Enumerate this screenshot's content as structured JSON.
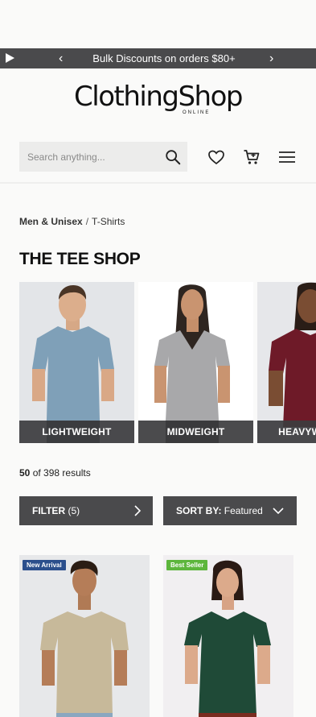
{
  "promo": {
    "text": "Bulk Discounts on  orders $80+",
    "play_icon": "play-icon",
    "prev_icon": "chevron-left-icon",
    "next_icon": "chevron-right-icon"
  },
  "logo": {
    "main": "ClothingShop",
    "sub": "ONLINE"
  },
  "search": {
    "placeholder": "Search anything...",
    "icon": "search-icon"
  },
  "header_icons": [
    "heart-icon",
    "cart-icon",
    "menu-icon"
  ],
  "breadcrumb": {
    "parent": "Men & Unisex",
    "separator": "/",
    "current": "T-Shirts"
  },
  "page_title": "THE TEE SHOP",
  "weight_categories": [
    {
      "label": "LIGHTWEIGHT",
      "shirt_color": "#7fa0b8",
      "bg": "#e3e5e8"
    },
    {
      "label": "MIDWEIGHT",
      "shirt_color": "#a8a8aa",
      "bg": "#ffffff"
    },
    {
      "label": "HEAVYWEIGHT",
      "shirt_color": "#6e1a28",
      "bg": "#e6e7ea"
    }
  ],
  "results": {
    "shown": "50",
    "text": "of 398 results"
  },
  "filter": {
    "label": "FILTER",
    "count": "(5)"
  },
  "sort": {
    "label": "SORT BY:",
    "value": "Featured"
  },
  "products": [
    {
      "badge": "New Arrival",
      "badge_color": "#2b4f8c",
      "shirt_color": "#c7b99a",
      "bg": "#e7e8ea"
    },
    {
      "badge": "Best Seller",
      "badge_color": "#5db63c",
      "shirt_color": "#1f4a37",
      "bg": "#f1eff1"
    }
  ]
}
